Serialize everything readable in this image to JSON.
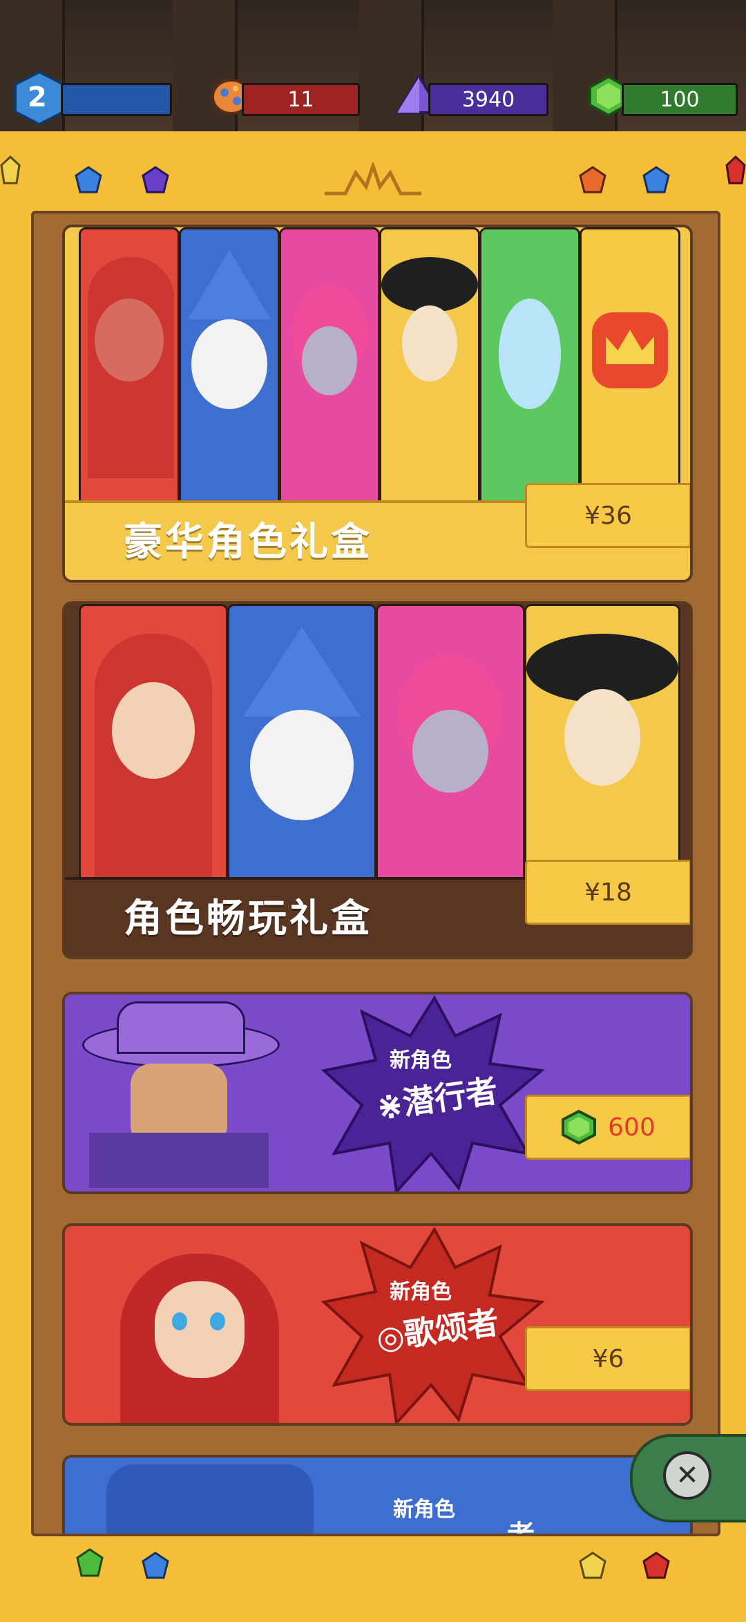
{
  "stats": {
    "level": "2",
    "ore": "11",
    "crystal": "3940",
    "gem": "100"
  },
  "colors": {
    "frame": "#f4be38",
    "deluxe": "#f4c84a",
    "play": "#5a3522",
    "sneaker": "#7a4ac8",
    "singer": "#e2493c",
    "next": "#3e6fd0"
  },
  "offers": [
    {
      "title": "豪华角色礼盒",
      "price": "¥36"
    },
    {
      "title": "角色畅玩礼盒",
      "price": "¥18"
    },
    {
      "tag": "新角色",
      "name": "潜行者",
      "price": "600",
      "currency_icon": "green-gem-icon"
    },
    {
      "tag": "新角色",
      "name": "歌颂者",
      "price": "¥6"
    },
    {
      "tag": "新角色",
      "name": "…者"
    }
  ]
}
